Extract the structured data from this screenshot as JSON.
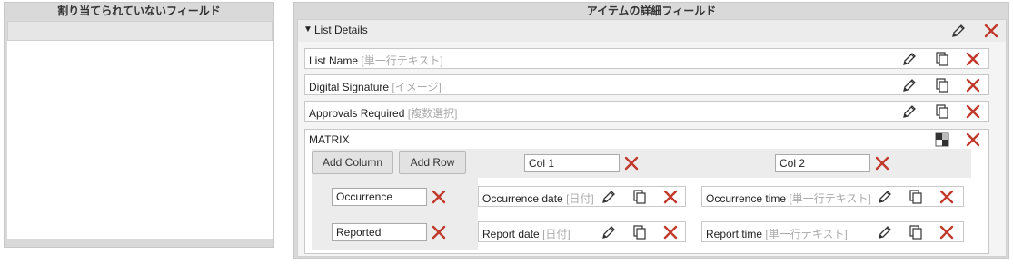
{
  "left_panel": {
    "title": "割り当てられていないフィールド"
  },
  "right_panel": {
    "title": "アイテムの詳細フィールド",
    "group": {
      "title": "List Details",
      "fields": [
        {
          "name": "List Name",
          "type": "[単一行テキスト]"
        },
        {
          "name": "Digital Signature",
          "type": "[イメージ]"
        },
        {
          "name": "Approvals Required",
          "type": "[複数選択]"
        }
      ],
      "matrix": {
        "label": "MATRIX",
        "add_column_label": "Add Column",
        "add_row_label": "Add Row",
        "columns": [
          "Col 1",
          "Col 2"
        ],
        "rows": [
          "Occurrence",
          "Reported"
        ],
        "cells": [
          [
            {
              "name": "Occurrence date",
              "type": "[日付]"
            },
            {
              "name": "Occurrence time",
              "type": "[単一行テキスト]"
            }
          ],
          [
            {
              "name": "Report date",
              "type": "[日付]"
            },
            {
              "name": "Report time",
              "type": "[単一行テキスト]"
            }
          ]
        ]
      }
    }
  },
  "icons": {
    "edit": "pencil-icon",
    "copy": "copy-icon",
    "delete": "close-icon",
    "matrix": "matrix-icon",
    "collapse": "triangle-down-icon"
  },
  "colors": {
    "delete": "#c0392b",
    "panel_bg": "#d9d9d9"
  }
}
